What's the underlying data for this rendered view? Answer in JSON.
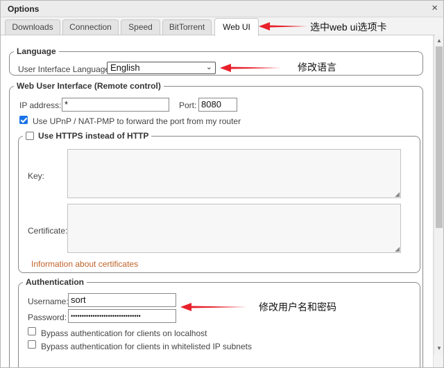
{
  "window": {
    "title": "Options",
    "close_glyph": "×"
  },
  "tabs": [
    {
      "label": "Downloads",
      "active": false
    },
    {
      "label": "Connection",
      "active": false
    },
    {
      "label": "Speed",
      "active": false
    },
    {
      "label": "BitTorrent",
      "active": false
    },
    {
      "label": "Web UI",
      "active": true
    }
  ],
  "language": {
    "legend": "Language",
    "label": "User Interface Language:",
    "selected": "English"
  },
  "webui": {
    "legend": "Web User Interface (Remote control)",
    "ip_label": "IP address:",
    "ip_value": "*",
    "port_label": "Port:",
    "port_value": "8080",
    "upnp_label": "Use UPnP / NAT-PMP to forward the port from my router",
    "upnp_checked": true
  },
  "https": {
    "legend": "Use HTTPS instead of HTTP",
    "checked": false,
    "key_label": "Key:",
    "cert_label": "Certificate:",
    "info_link": "Information about certificates"
  },
  "auth": {
    "legend": "Authentication",
    "username_label": "Username:",
    "username_value": "sort",
    "password_label": "Password:",
    "password_value": "••••••••••••••••••••••••••••••••",
    "bypass_localhost": "Bypass authentication for clients on localhost",
    "bypass_whitelist": "Bypass authentication for clients in whitelisted IP subnets"
  },
  "annotations": {
    "tab_note": "选中web ui选项卡",
    "lang_note": "修改语言",
    "auth_note": "修改用户名和密码",
    "arrow_color": "#e8202a"
  }
}
